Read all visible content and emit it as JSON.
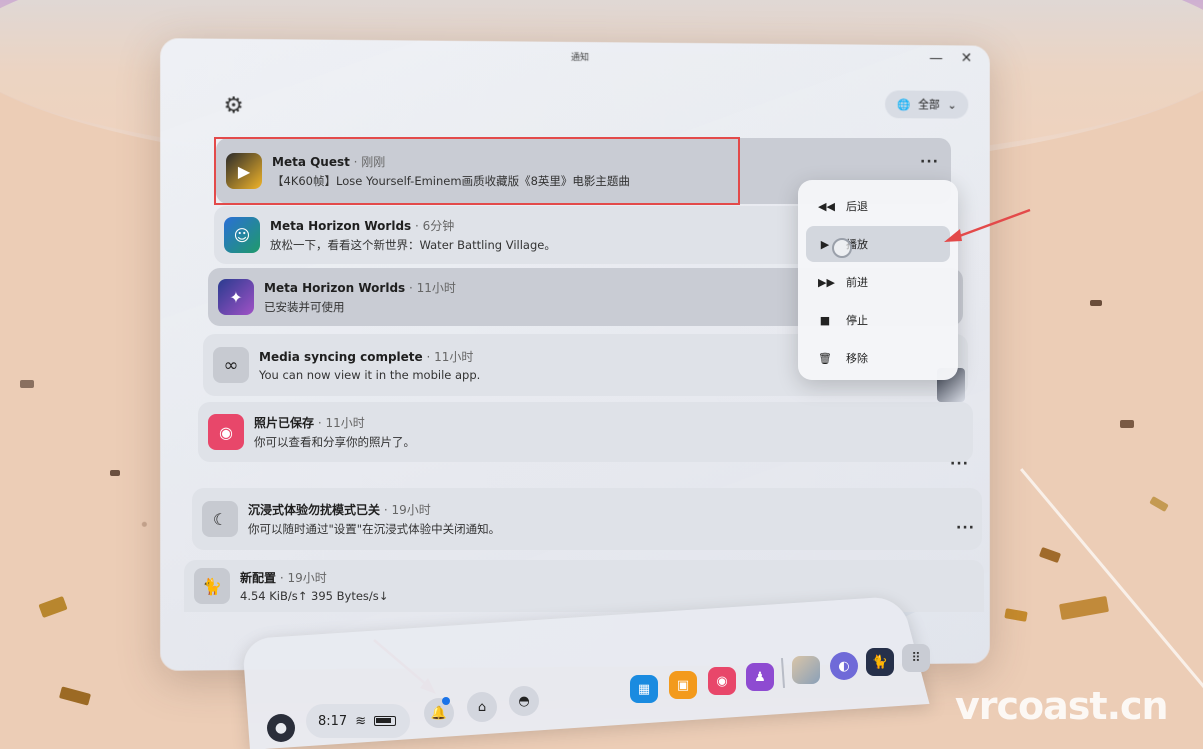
{
  "panel": {
    "title": "通知",
    "filter_label": "全部"
  },
  "notifications": [
    {
      "app": "Meta Quest",
      "time": " · 刚刚",
      "body": "【4K60帧】Lose Yourself-Eminem画质收藏版《8英里》电影主题曲"
    },
    {
      "app": "Meta Horizon Worlds",
      "time": " · 6分钟",
      "body": "放松一下，看看这个新世界：Water Battling Village。"
    },
    {
      "app": "Meta Horizon Worlds",
      "time": " · 11小时",
      "body": "已安装并可使用"
    },
    {
      "app": "Media syncing complete",
      "time": " · 11小时",
      "body": "You can now view it in the mobile app."
    },
    {
      "app": "照片已保存",
      "time": " · 11小时",
      "body": "你可以查看和分享你的照片了。"
    },
    {
      "app": "沉浸式体验勿扰模式已关",
      "time": " · 19小时",
      "body": "你可以随时通过\"设置\"在沉浸式体验中关闭通知。"
    },
    {
      "app": "新配置",
      "time": " · 19小时",
      "body": "4.54 KiB/s↑  395 Bytes/s↓"
    }
  ],
  "media_menu": {
    "items": [
      {
        "label": "后退",
        "icon": "rewind-icon"
      },
      {
        "label": "播放",
        "icon": "play-icon"
      },
      {
        "label": "前进",
        "icon": "fast-forward-icon"
      },
      {
        "label": "停止",
        "icon": "stop-icon"
      },
      {
        "label": "移除",
        "icon": "trash-icon"
      }
    ]
  },
  "taskbar": {
    "time": "8:17"
  },
  "watermark": "vrcoast.cn",
  "colors": {
    "annotation_red": "#e34a4a",
    "camera_app": "#e8476a",
    "notification_badge": "#1a73e8"
  }
}
